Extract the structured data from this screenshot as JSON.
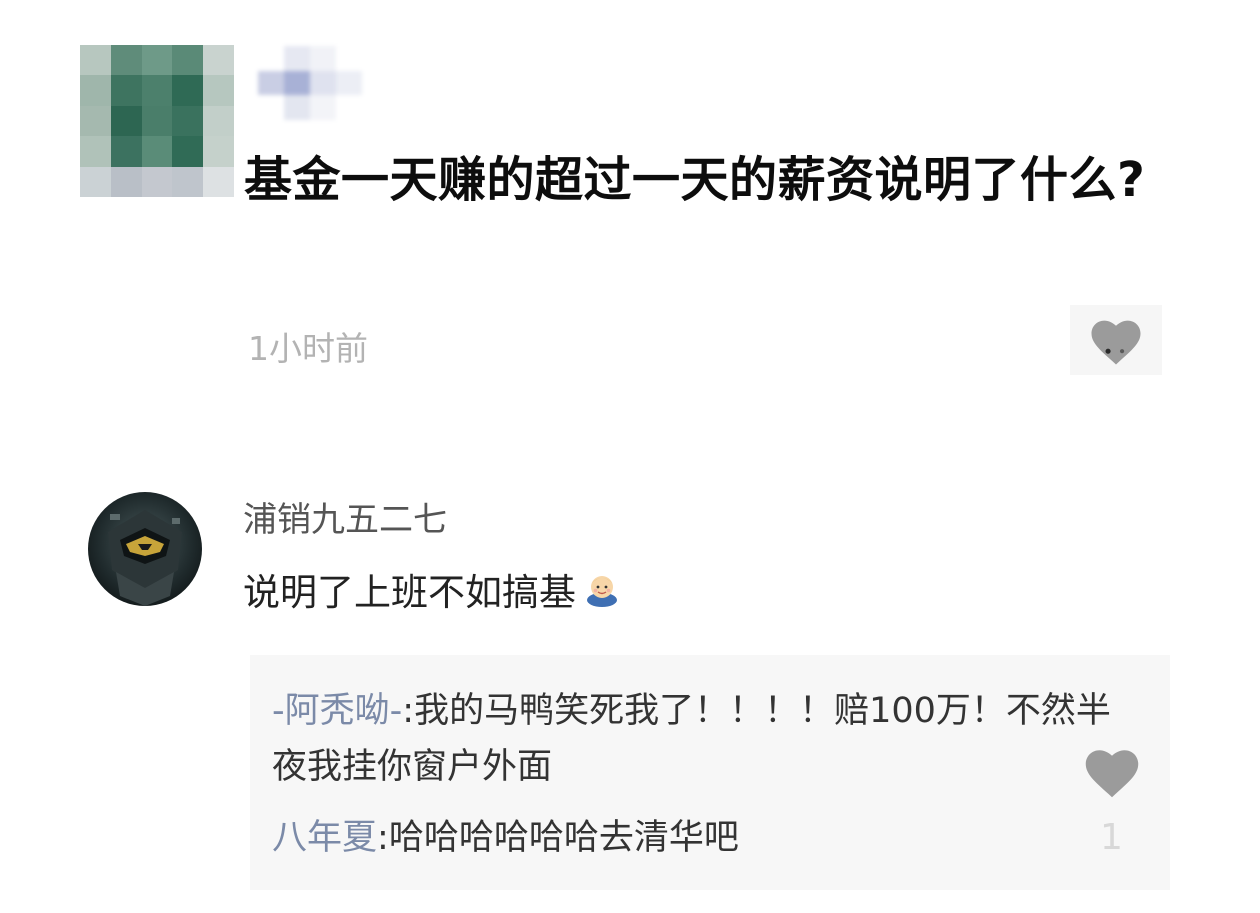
{
  "post": {
    "title": "基金一天赚的超过一天的薪资说明了什么?",
    "time": "1小时前",
    "avatar_icon": "pixelated-avatar",
    "like_icon": "heart-icon"
  },
  "comment": {
    "author": "浦销九五二七",
    "text": "说明了上班不如搞基",
    "emoji": "baby-emoji",
    "replies": [
      {
        "author": "-阿秃呦-",
        "separator": ":",
        "text": "我的马鸭笑死我了！！！！赔100万！不然半夜我挂你窗户外面"
      },
      {
        "author": "八年夏",
        "separator": ":",
        "text": "哈哈哈哈哈哈去清华吧"
      }
    ],
    "like_icon": "heart-icon",
    "like_count": "1"
  },
  "colors": {
    "title": "#0d0d0d",
    "time": "#b3b3b3",
    "reply_author": "#7b8aa8",
    "heart": "#9b9b9b",
    "reply_bg": "#f7f7f7"
  }
}
